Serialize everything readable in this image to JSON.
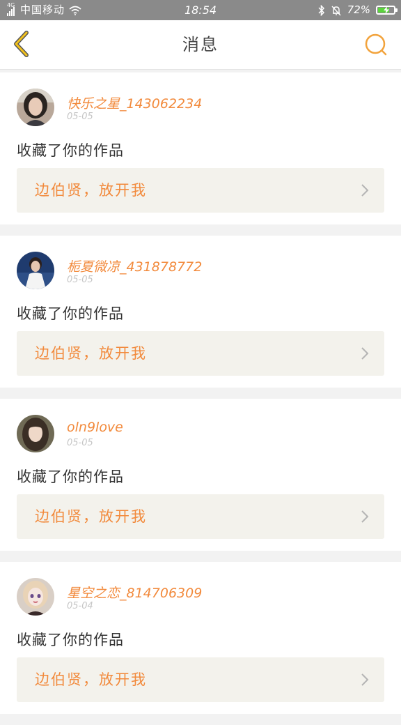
{
  "status_bar": {
    "network": "4G",
    "carrier": "中国移动",
    "time": "18:54",
    "battery": "72%",
    "battery_level": 0.72,
    "battery_color": "#5ad43c"
  },
  "header": {
    "title": "消息",
    "back_icon": "chevron-left-icon",
    "search_icon": "search-icon",
    "accent_color": "#f2a33c"
  },
  "messages": [
    {
      "username": "快乐之星_143062234",
      "date": "05-05",
      "text": "收藏了你的作品",
      "work_title": "边伯贤，放开我",
      "avatar": "avatar-girl-dark-hair"
    },
    {
      "username": "栀夏微凉_431878772",
      "date": "05-05",
      "text": "收藏了你的作品",
      "work_title": "边伯贤，放开我",
      "avatar": "avatar-boy-white-shirt"
    },
    {
      "username": "oln9love",
      "date": "05-05",
      "text": "收藏了你的作品",
      "work_title": "边伯贤，放开我",
      "avatar": "avatar-girl-long-hair"
    },
    {
      "username": "星空之恋_814706309",
      "date": "05-04",
      "text": "收藏了你的作品",
      "work_title": "边伯贤，放开我",
      "avatar": "avatar-doll"
    }
  ]
}
